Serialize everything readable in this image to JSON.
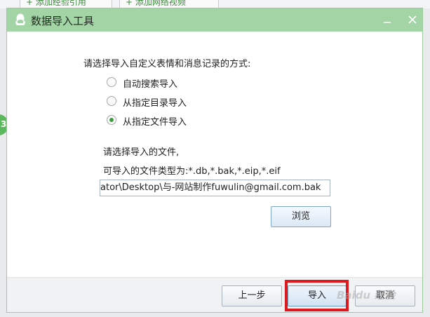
{
  "background": {
    "tabs": [
      "+ 添加经验引用",
      "+ 添加网络视频"
    ],
    "badge": "3"
  },
  "dialog": {
    "title": "数据导入工具",
    "icons": {
      "logo": "qq-penguin-icon",
      "minimize": "minimize-icon",
      "close": "close-icon"
    },
    "prompt": "请选择导入自定义表情和消息记录的方式:",
    "options": [
      {
        "label": "自动搜索导入",
        "checked": false
      },
      {
        "label": "从指定目录导入",
        "checked": false
      },
      {
        "label": "从指定文件导入",
        "checked": true
      }
    ],
    "file_hint": "请选择导入的文件,",
    "file_types": "可导入的文件类型为:*.db,*.bak,*.eip,*.eif",
    "file_path": "ator\\Desktop\\与-网站制作fuwulin@gmail.com.bak",
    "browse_label": "浏览",
    "footer": {
      "prev_label": "上一步",
      "import_label": "导入",
      "cancel_label": "取消"
    }
  },
  "watermark": "Baidu 经验",
  "colors": {
    "titlebar": "#a3d4a6",
    "highlight": "#e0191f",
    "radio_dot": "#3f9a3f"
  }
}
